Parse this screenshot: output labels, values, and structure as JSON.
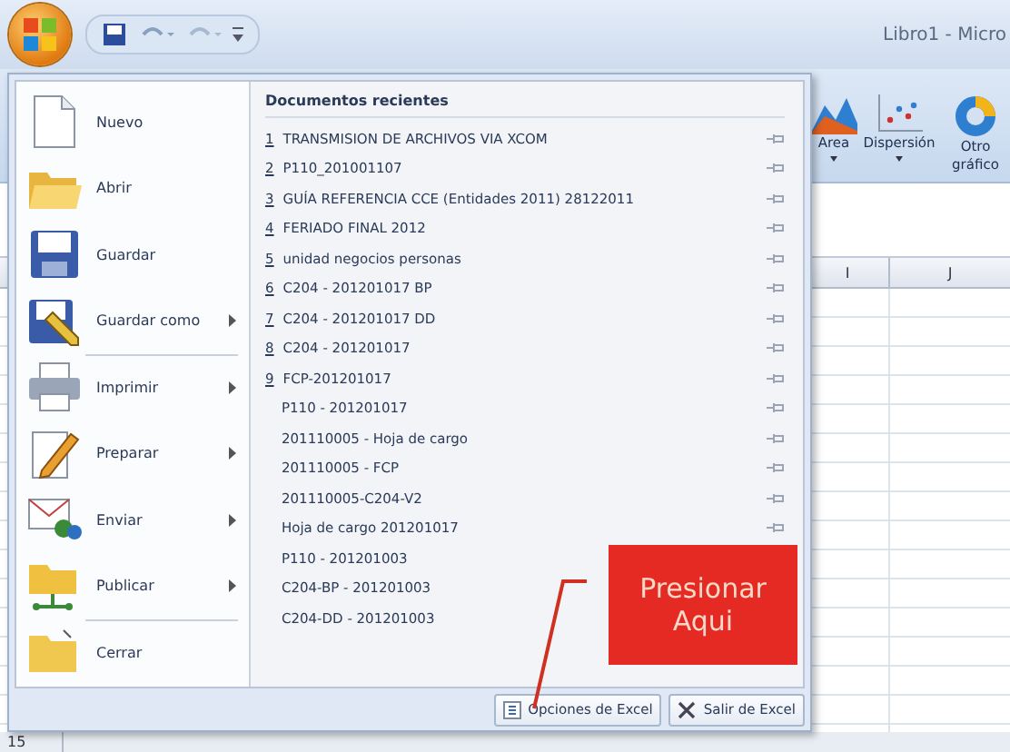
{
  "window": {
    "title": "Libro1 - Micro"
  },
  "ribbon": {
    "buttons": [
      {
        "label": "Area",
        "kind": "area"
      },
      {
        "label": "Dispersión",
        "kind": "scatter"
      },
      {
        "label": "Otro gráfico",
        "kind": "donut"
      }
    ]
  },
  "spreadsheet": {
    "columns": [
      "I",
      "J"
    ],
    "row_labels": [
      "15"
    ]
  },
  "office_menu": {
    "items": [
      {
        "label": "Nuevo",
        "kind": "new",
        "has_submenu": false,
        "divider_above": false
      },
      {
        "label": "Abrir",
        "kind": "open",
        "has_submenu": false,
        "divider_above": false
      },
      {
        "label": "Guardar",
        "kind": "save",
        "has_submenu": false,
        "divider_above": false
      },
      {
        "label": "Guardar como",
        "kind": "save-as",
        "has_submenu": true,
        "divider_above": false
      },
      {
        "label": "Imprimir",
        "kind": "print",
        "has_submenu": true,
        "divider_above": true
      },
      {
        "label": "Preparar",
        "kind": "prepare",
        "has_submenu": true,
        "divider_above": false
      },
      {
        "label": "Enviar",
        "kind": "send",
        "has_submenu": true,
        "divider_above": false
      },
      {
        "label": "Publicar",
        "kind": "publish",
        "has_submenu": true,
        "divider_above": false
      },
      {
        "label": "Cerrar",
        "kind": "close",
        "has_submenu": false,
        "divider_above": true
      }
    ],
    "recent_title": "Documentos recientes",
    "recent": [
      {
        "number": "1",
        "name": "TRANSMISION DE ARCHIVOS VIA XCOM"
      },
      {
        "number": "2",
        "name": "P110_201001107"
      },
      {
        "number": "3",
        "name": "GUÍA REFERENCIA CCE (Entidades 2011) 28122011"
      },
      {
        "number": "4",
        "name": "FERIADO FINAL 2012"
      },
      {
        "number": "5",
        "name": "unidad negocios personas"
      },
      {
        "number": "6",
        "name": "C204 - 201201017 BP"
      },
      {
        "number": "7",
        "name": "C204 - 201201017 DD"
      },
      {
        "number": "8",
        "name": "C204 - 201201017"
      },
      {
        "number": "9",
        "name": "FCP-201201017"
      },
      {
        "name": "P110 - 201201017"
      },
      {
        "name": "201110005 - Hoja de cargo"
      },
      {
        "name": "201110005 - FCP"
      },
      {
        "name": "201110005-C204-V2"
      },
      {
        "name": "Hoja de cargo 201201017"
      },
      {
        "name": "P110 - 201201003"
      },
      {
        "name": "C204-BP - 201201003"
      },
      {
        "name": "C204-DD - 201201003"
      }
    ],
    "footer_buttons": [
      {
        "label": "Opciones de Excel",
        "kind": "options"
      },
      {
        "label": "Salir de Excel",
        "kind": "exit"
      }
    ]
  },
  "callout": {
    "text": "Presionar Aqui"
  }
}
